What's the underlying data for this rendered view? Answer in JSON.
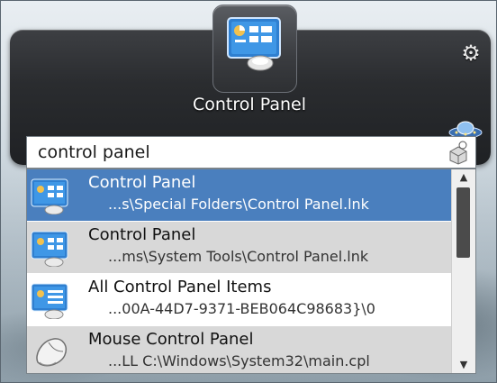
{
  "launcher": {
    "title": "Control Panel",
    "query": "control panel",
    "icons": {
      "main": "control-panel-icon",
      "settings": "gear-icon",
      "skin": "saucer-icon",
      "search": "search-icon"
    }
  },
  "results": [
    {
      "name": "Control Panel",
      "path": "...s\\Special Folders\\Control Panel.lnk",
      "icon": "control-panel-icon",
      "selected": true
    },
    {
      "name": "Control Panel",
      "path": "...ms\\System Tools\\Control Panel.lnk",
      "icon": "control-panel-icon",
      "selected": false
    },
    {
      "name": "All Control Panel Items",
      "path": "...00A-44D7-9371-BEB064C98683}\\0",
      "icon": "control-panel-icon",
      "selected": false
    },
    {
      "name": "Mouse Control Panel",
      "path": "...LL C:\\Windows\\System32\\main.cpl",
      "icon": "mouse-icon",
      "selected": false
    }
  ],
  "scrollbar": {
    "up": "▲",
    "down": "▼"
  },
  "colors": {
    "selection": "#4a7fbe",
    "row": "#d8d8d8",
    "panel": "#2a2c2f"
  }
}
